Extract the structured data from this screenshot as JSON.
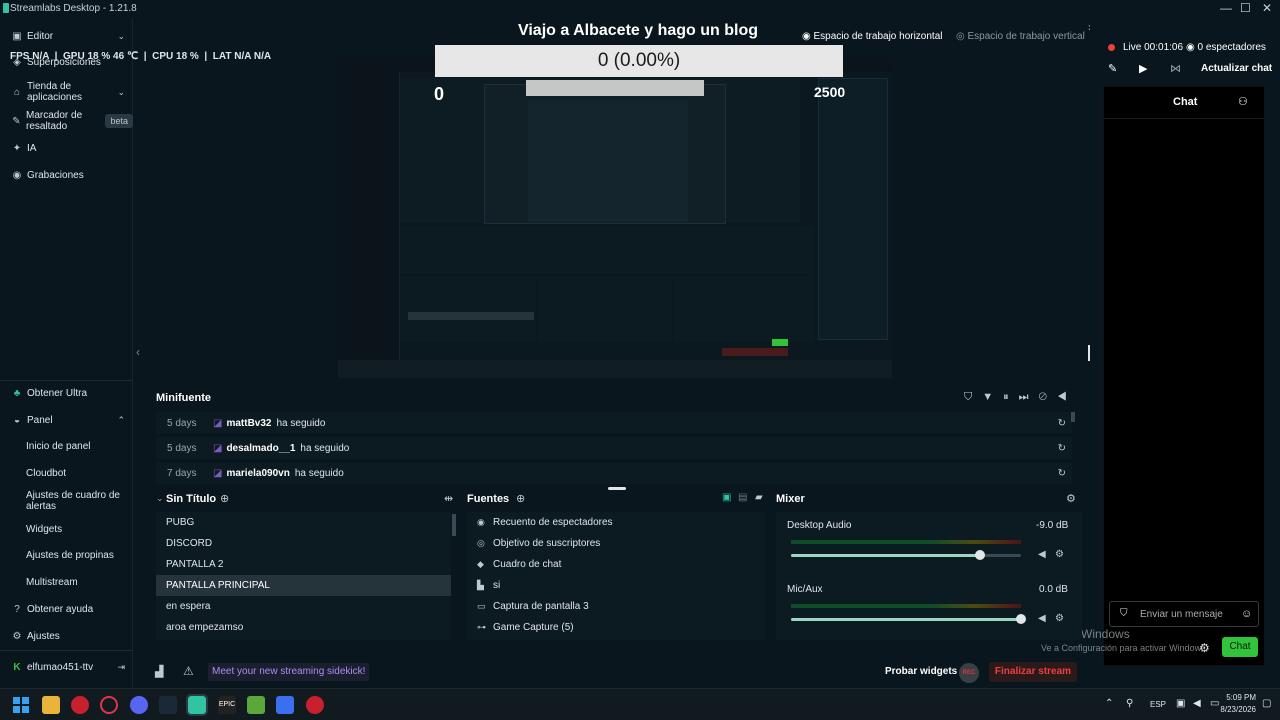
{
  "window": {
    "title": "Streamlabs Desktop - 1.21.8",
    "minimize": "—",
    "maximize": "☐",
    "close": "✕"
  },
  "stats": {
    "fps_label": "FPS",
    "fps": "N/A",
    "gpu_label": "GPU",
    "gpu": "18 %",
    "gpu_temp": "46 ℃",
    "cpu_label": "CPU",
    "cpu": "18 %",
    "lat_label": "LAT",
    "lat": "N/A",
    "lat2": "N/A"
  },
  "sidebar": {
    "editor": "Editor",
    "overlays": "Superposiciones",
    "app_store": "Tienda de aplicaciones",
    "highlighter": "Marcador de resaltado",
    "beta": "beta",
    "ai": "IA",
    "recordings": "Grabaciones",
    "get_ultra": "Obtener Ultra",
    "panel": "Panel",
    "panel_items": [
      "Inicio de panel",
      "Cloudbot",
      "Ajustes de cuadro de alertas",
      "Widgets",
      "Ajustes de propinas",
      "Multistream"
    ],
    "get_help": "Obtener ayuda",
    "settings": "Ajustes",
    "user": "elfumao451-ttv"
  },
  "preview": {
    "stream_title": "Viajo a Albacete y hago un blog",
    "goal": "0 (0.00%)",
    "inner_left_counter": "0",
    "inner_right_counter": "2500",
    "workspace_horizontal": "Espacio de trabajo horizontal",
    "workspace_vertical": "Espacio de trabajo vertical"
  },
  "live": {
    "time": "Live 00:01:06",
    "viewers": "0 espectadores",
    "refresh_chat": "Actualizar chat",
    "chat_tab": "Chat"
  },
  "chat": {
    "placeholder": "Enviar un mensaje",
    "send": "Chat"
  },
  "minifuente": {
    "title": "Minifuente",
    "rows": [
      {
        "when": "5 days",
        "user": "mattBv32",
        "action": "ha seguido"
      },
      {
        "when": "5 days",
        "user": "desalmado__1",
        "action": "ha seguido"
      },
      {
        "when": "7 days",
        "user": "mariela090vn",
        "action": "ha seguido"
      }
    ]
  },
  "scenes": {
    "title": "Sin Título",
    "items": [
      "PUBG",
      "DISCORD",
      "PANTALLA 2",
      "PANTALLA PRINCIPAL",
      "en espera",
      "aroa empezamso"
    ],
    "selected": 3
  },
  "sources": {
    "title": "Fuentes",
    "items": [
      {
        "icon": "eye-icon",
        "label": "Recuento de espectadores"
      },
      {
        "icon": "target-icon",
        "label": "Objetivo de suscriptores"
      },
      {
        "icon": "chat-icon",
        "label": "Cuadro de chat"
      },
      {
        "icon": "window-icon",
        "label": "si"
      },
      {
        "icon": "monitor-icon",
        "label": "Captura de pantalla 3"
      },
      {
        "icon": "gamepad-icon",
        "label": "Game Capture (5)"
      }
    ]
  },
  "mixer": {
    "title": "Mixer",
    "channels": [
      {
        "name": "Desktop Audio",
        "db": "-9.0 dB",
        "level": 0.82
      },
      {
        "name": "Mic/Aux",
        "db": "0.0 dB",
        "level": 1.0
      }
    ]
  },
  "footer": {
    "sidekick": "Meet your new streaming sidekick!",
    "test_widgets": "Probar widgets",
    "rec": "REC",
    "end_stream": "Finalizar stream"
  },
  "watermark": {
    "line1": "Activar Windows",
    "line2": "Ve a Configuración para activar Windows."
  },
  "taskbar": {
    "lang": "ESP",
    "time": "5:09 PM",
    "date": "8/23/2026"
  }
}
